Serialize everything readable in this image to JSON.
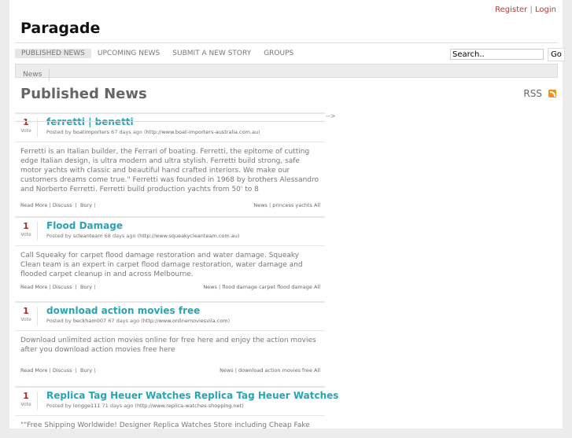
{
  "header": {
    "register": "Register",
    "sep": "|",
    "login": "Login",
    "site_title": "Paragade"
  },
  "nav": {
    "items": [
      "PUBLISHED NEWS",
      "UPCOMING NEWS",
      "SUBMIT A NEW STORY",
      "GROUPS"
    ],
    "active": 0
  },
  "search": {
    "value": "Search..",
    "go": "Go"
  },
  "subnav": {
    "items": [
      "News"
    ]
  },
  "page": {
    "heading": "Published News",
    "rss": "RSS",
    "stray": "-->"
  },
  "stories": [
    {
      "votes": "1",
      "vote_label": "Vote",
      "title": "ferretti | benetti",
      "posted_by": "Posted by",
      "user": "boatimporters",
      "ago": "67 days ago",
      "url": "http://www.boat-importers-australia.com.au",
      "body": "Ferretti is an Italian builder, the Ferrari of boating. Ferretti, the epitome of cutting edge Italian design, is ultra modern and ultra stylish. Ferretti build strong, safe motor yachts with classic and beautiful hand crafted interiors. We make our customers dreams come true.\" Ferretti was founded in 1968 by brothers Alessandro and Norberto Ferretti. Ferretti build production yachts from 50' to 8",
      "read_more": "Read More",
      "discuss": "Discuss",
      "bury": "Bury",
      "category": "News",
      "tags": [
        "princess yachts"
      ],
      "all": "All"
    },
    {
      "votes": "1",
      "vote_label": "Vote",
      "title": "Flood Damage",
      "posted_by": "Posted by",
      "user": "scleanteam",
      "ago": "68 days ago",
      "url": "http://www.squeakycleanteam.com.au",
      "body": "Call Squeaky for carpet flood damage restoration and water damage. Squeaky Clean team is an expert in carpet flood damage restoration, water damage and flooded carpet cleanup in and across Melbourne.",
      "read_more": "Read More",
      "discuss": "Discuss",
      "bury": "Bury",
      "category": "News",
      "tags": [
        "flood damage",
        "carpet flood damage"
      ],
      "all": "All"
    },
    {
      "votes": "1",
      "vote_label": "Vote",
      "title": "download action movies free",
      "posted_by": "Posted by",
      "user": "beckham007",
      "ago": "67 days ago",
      "url": "http://www.onlinemoviesvila.com",
      "body": "Download unlimited action movies online for free here and enjoy the action movies after you download action movies free here",
      "read_more": "Read More",
      "discuss": "Discuss",
      "bury": "Bury",
      "category": "News",
      "tags": [
        "download action movies free"
      ],
      "all": "All"
    },
    {
      "votes": "1",
      "vote_label": "Vote",
      "title": "Replica Tag Heuer Watches Replica Tag Heuer Watches",
      "posted_by": "Posted by",
      "user": "longge111",
      "ago": "71 days ago",
      "url": "http://www.replica-watches-shopping.net",
      "body": "\"\"Free Shipping Worldwide! Designer Replica Watches Store including Cheap Fake"
    }
  ]
}
